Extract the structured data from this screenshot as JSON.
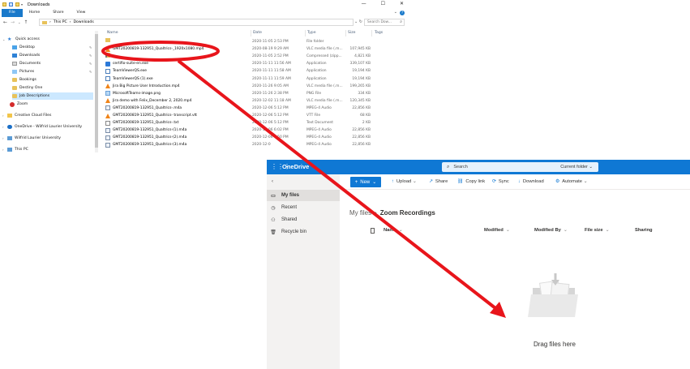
{
  "explorer": {
    "title": "Downloads",
    "ribbon_tabs": [
      "File",
      "Home",
      "Share",
      "View"
    ],
    "address": [
      "This PC",
      "Downloads"
    ],
    "search_placeholder": "Search Dow...",
    "columns": {
      "name": "Name",
      "date": "Date",
      "type": "Type",
      "size": "Size",
      "tags": "Tags"
    },
    "nav": [
      {
        "label": "Quick access",
        "icon": "star-icon",
        "pinned": false
      },
      {
        "label": "Desktop",
        "icon": "desktop-icon",
        "pinned": true
      },
      {
        "label": "Downloads",
        "icon": "downloads-icon",
        "pinned": true
      },
      {
        "label": "Documents",
        "icon": "documents-icon",
        "pinned": true
      },
      {
        "label": "Pictures",
        "icon": "pictures-icon",
        "pinned": true
      },
      {
        "label": "Bookings",
        "icon": "folder-icon",
        "pinned": false
      },
      {
        "label": "Destiny One",
        "icon": "folder-icon",
        "pinned": false
      },
      {
        "label": "Job Descriptions",
        "icon": "folder-icon",
        "pinned": false
      },
      {
        "label": "Zoom",
        "icon": "zoom-icon",
        "pinned": false
      },
      {
        "label": "Creative Cloud Files",
        "icon": "creative-cloud-icon",
        "pinned": false
      },
      {
        "label": "OneDrive - Wilfrid Laurier University",
        "icon": "onedrive-icon",
        "pinned": false
      },
      {
        "label": "Wilfrid Laurier University",
        "icon": "building-icon",
        "pinned": false
      },
      {
        "label": "This PC",
        "icon": "this-pc-icon",
        "pinned": false
      }
    ],
    "files": [
      {
        "name": "",
        "date": "2020-11-05 2:53 PM",
        "type": "File folder",
        "size": "",
        "icon": "folder"
      },
      {
        "name": "GMT20200819-132951_Qualtrics-_1920x1080.mp4",
        "date": "2020-08-19 9:29 AM",
        "type": "VLC media file (.m...",
        "size": "107,945 KB",
        "icon": "vlc"
      },
      {
        "name": "",
        "date": "2020-11-05 2:52 PM",
        "type": "Compressed (zipp...",
        "size": "4,821 KB",
        "icon": "zip"
      },
      {
        "name": "certifio-suite-en.exe",
        "date": "2020-11-11 11:56 AM",
        "type": "Application",
        "size": "339,107 KB",
        "icon": "app"
      },
      {
        "name": "TeamViewerQS.exe",
        "date": "2020-11-11 11:58 AM",
        "type": "Application",
        "size": "19,194 KB",
        "icon": "exe"
      },
      {
        "name": "TeamViewerQS (1).exe",
        "date": "2020-11-11 11:59 AM",
        "type": "Application",
        "size": "19,194 KB",
        "icon": "exe"
      },
      {
        "name": "Jira Big Picture User Introduction.mp4",
        "date": "2020-11-26 9:05 AM",
        "type": "VLC media file (.m...",
        "size": "199,265 KB",
        "icon": "vlc"
      },
      {
        "name": "MicrosoftTeams-image.png",
        "date": "2020-11-26 2:38 PM",
        "type": "PNG File",
        "size": "334 KB",
        "icon": "png"
      },
      {
        "name": "Jira demo with Felix_December 2, 2020.mp4",
        "date": "2020-12-02 11:18 AM",
        "type": "VLC media file (.m...",
        "size": "120,345 KB",
        "icon": "vlc"
      },
      {
        "name": "GMT20200819-132951_Qualtrics-.m4a",
        "date": "2020-12-06 5:12 PM",
        "type": "MPEG-4 Audio",
        "size": "22,856 KB",
        "icon": "m4a"
      },
      {
        "name": "GMT20200819-132951_Qualtrics- transcript.vtt",
        "date": "2020-12-06 5:12 PM",
        "type": "VTT File",
        "size": "68 KB",
        "icon": "vlc"
      },
      {
        "name": "GMT20200819-132951_Qualtrics-.txt",
        "date": "2020-12-06 5:12 PM",
        "type": "Text Document",
        "size": "2 KB",
        "icon": "txt"
      },
      {
        "name": "GMT20200819-132951_Qualtrics-(1).m4a",
        "date": "2020-12-06 6:02 PM",
        "type": "MPEG-4 Audio",
        "size": "22,856 KB",
        "icon": "m4a"
      },
      {
        "name": "GMT20200819-132951_Qualtrics-(2).m4a",
        "date": "2020-12-06 6:50 PM",
        "type": "MPEG-4 Audio",
        "size": "22,856 KB",
        "icon": "m4a"
      },
      {
        "name": "GMT20200819-132951_Qualtrics-(3).m4a",
        "date": "2020-12-0",
        "type": "MPEG-4 Audio",
        "size": "22,856 KB",
        "icon": "m4a"
      }
    ]
  },
  "onedrive": {
    "brand": "OneDrive",
    "search_placeholder": "Search",
    "search_scope": "Current folder",
    "nav": [
      {
        "label": "My files",
        "icon": "folder-outline-icon",
        "active": true
      },
      {
        "label": "Recent",
        "icon": "clock-icon",
        "active": false
      },
      {
        "label": "Shared",
        "icon": "people-icon",
        "active": false
      },
      {
        "label": "Recycle bin",
        "icon": "trash-icon",
        "active": false
      }
    ],
    "commands": {
      "new": "New",
      "upload": "Upload",
      "share": "Share",
      "copy_link": "Copy link",
      "sync": "Sync",
      "download": "Download",
      "automate": "Automate"
    },
    "breadcrumb": {
      "parent": "My files",
      "current": "Zoom Recordings"
    },
    "columns": {
      "name": "Name",
      "modified": "Modified",
      "modified_by": "Modified By",
      "file_size": "File size",
      "sharing": "Sharing"
    },
    "empty_text": "Drag files here"
  },
  "colors": {
    "onedrive_blue": "#0f78d4",
    "annotation_red": "#e8151b",
    "explorer_file_tab": "#1979ca"
  }
}
